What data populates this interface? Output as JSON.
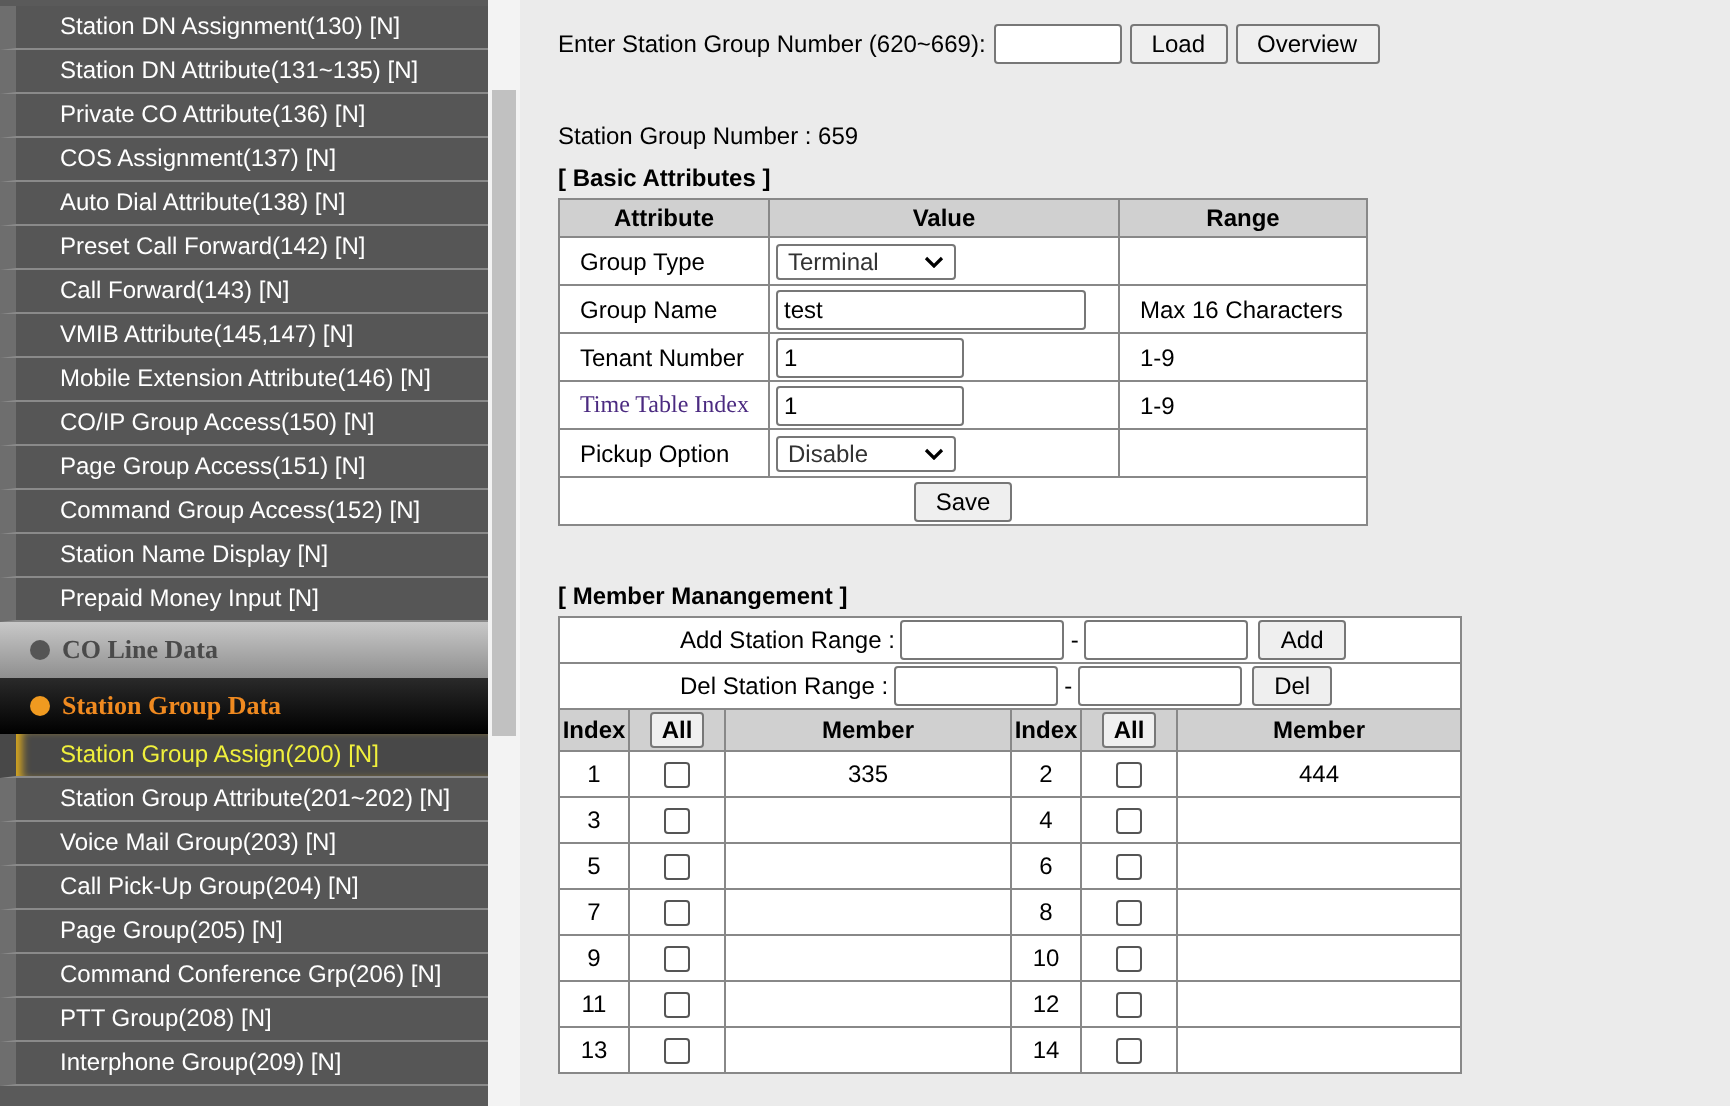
{
  "sidebar": {
    "items": [
      {
        "kind": "item",
        "label": "Station DN Assignment(130) [N]",
        "selected": false
      },
      {
        "kind": "item",
        "label": "Station DN Attribute(131~135) [N]",
        "selected": false
      },
      {
        "kind": "item",
        "label": "Private CO Attribute(136) [N]",
        "selected": false
      },
      {
        "kind": "item",
        "label": "COS Assignment(137) [N]",
        "selected": false
      },
      {
        "kind": "item",
        "label": "Auto Dial Attribute(138) [N]",
        "selected": false
      },
      {
        "kind": "item",
        "label": "Preset Call Forward(142) [N]",
        "selected": false
      },
      {
        "kind": "item",
        "label": "Call Forward(143) [N]",
        "selected": false
      },
      {
        "kind": "item",
        "label": "VMIB Attribute(145,147) [N]",
        "selected": false
      },
      {
        "kind": "item",
        "label": "Mobile Extension Attribute(146) [N]",
        "selected": false
      },
      {
        "kind": "item",
        "label": "CO/IP Group Access(150) [N]",
        "selected": false
      },
      {
        "kind": "item",
        "label": "Page Group Access(151) [N]",
        "selected": false
      },
      {
        "kind": "item",
        "label": "Command Group Access(152) [N]",
        "selected": false
      },
      {
        "kind": "item",
        "label": "Station Name Display [N]",
        "selected": false
      },
      {
        "kind": "item",
        "label": "Prepaid Money Input [N]",
        "selected": false
      },
      {
        "kind": "section",
        "label": "CO Line Data",
        "selected": false
      },
      {
        "kind": "section",
        "label": "Station Group Data",
        "selected": true
      },
      {
        "kind": "item",
        "label": "Station Group Assign(200) [N]",
        "selected": true
      },
      {
        "kind": "item",
        "label": "Station Group Attribute(201~202) [N]",
        "selected": false
      },
      {
        "kind": "item",
        "label": "Voice Mail Group(203) [N]",
        "selected": false
      },
      {
        "kind": "item",
        "label": "Call Pick-Up Group(204) [N]",
        "selected": false
      },
      {
        "kind": "item",
        "label": "Page Group(205) [N]",
        "selected": false
      },
      {
        "kind": "item",
        "label": "Command Conference Grp(206) [N]",
        "selected": false
      },
      {
        "kind": "item",
        "label": "PTT Group(208) [N]",
        "selected": false
      },
      {
        "kind": "item",
        "label": "Interphone Group(209) [N]",
        "selected": false
      }
    ]
  },
  "lookup": {
    "label": "Enter Station Group Number (620~669):",
    "buttons": [
      "Load",
      "Overview"
    ]
  },
  "current": "Station Group Number : 659",
  "basic": {
    "title": "[ Basic Attributes ]",
    "columns": [
      "Attribute",
      "Value",
      "Range"
    ],
    "rows": [
      {
        "attribute": "Group Type",
        "kind": "select",
        "value": "Terminal",
        "link": false
      },
      {
        "attribute": "Group Name",
        "kind": "wide",
        "value": "test",
        "range": "Max 16 Characters",
        "link": false
      },
      {
        "attribute": "Tenant Number",
        "kind": "input",
        "value": "1",
        "range": "1-9",
        "link": false
      },
      {
        "attribute": "Time Table Index",
        "kind": "input",
        "value": "1",
        "range": "1-9",
        "link": true
      },
      {
        "attribute": "Pickup Option",
        "kind": "select",
        "value": "Disable",
        "link": false
      }
    ],
    "save": "Save"
  },
  "members": {
    "title": "[ Member Manangement ]",
    "ranges": [
      {
        "label": "Add Station Range :",
        "dash": "-",
        "button": "Add"
      },
      {
        "label": "Del Station Range :",
        "dash": "-",
        "button": "Del"
      }
    ],
    "columns": [
      "Index",
      "All",
      "Member",
      "Index",
      "All",
      "Member"
    ],
    "rows": [
      [
        {
          "index": "1",
          "checked": false,
          "member": "335"
        },
        {
          "index": "2",
          "checked": false,
          "member": "444"
        }
      ],
      [
        {
          "index": "3",
          "checked": false
        },
        {
          "index": "4",
          "checked": false
        }
      ],
      [
        {
          "index": "5",
          "checked": false
        },
        {
          "index": "6",
          "checked": false
        }
      ],
      [
        {
          "index": "7",
          "checked": false
        },
        {
          "index": "8",
          "checked": false
        }
      ],
      [
        {
          "index": "9",
          "checked": false
        },
        {
          "index": "10",
          "checked": false
        }
      ],
      [
        {
          "index": "11",
          "checked": false
        },
        {
          "index": "12",
          "checked": false
        }
      ],
      [
        {
          "index": "13",
          "checked": false
        },
        {
          "index": "14",
          "checked": false
        }
      ]
    ]
  }
}
